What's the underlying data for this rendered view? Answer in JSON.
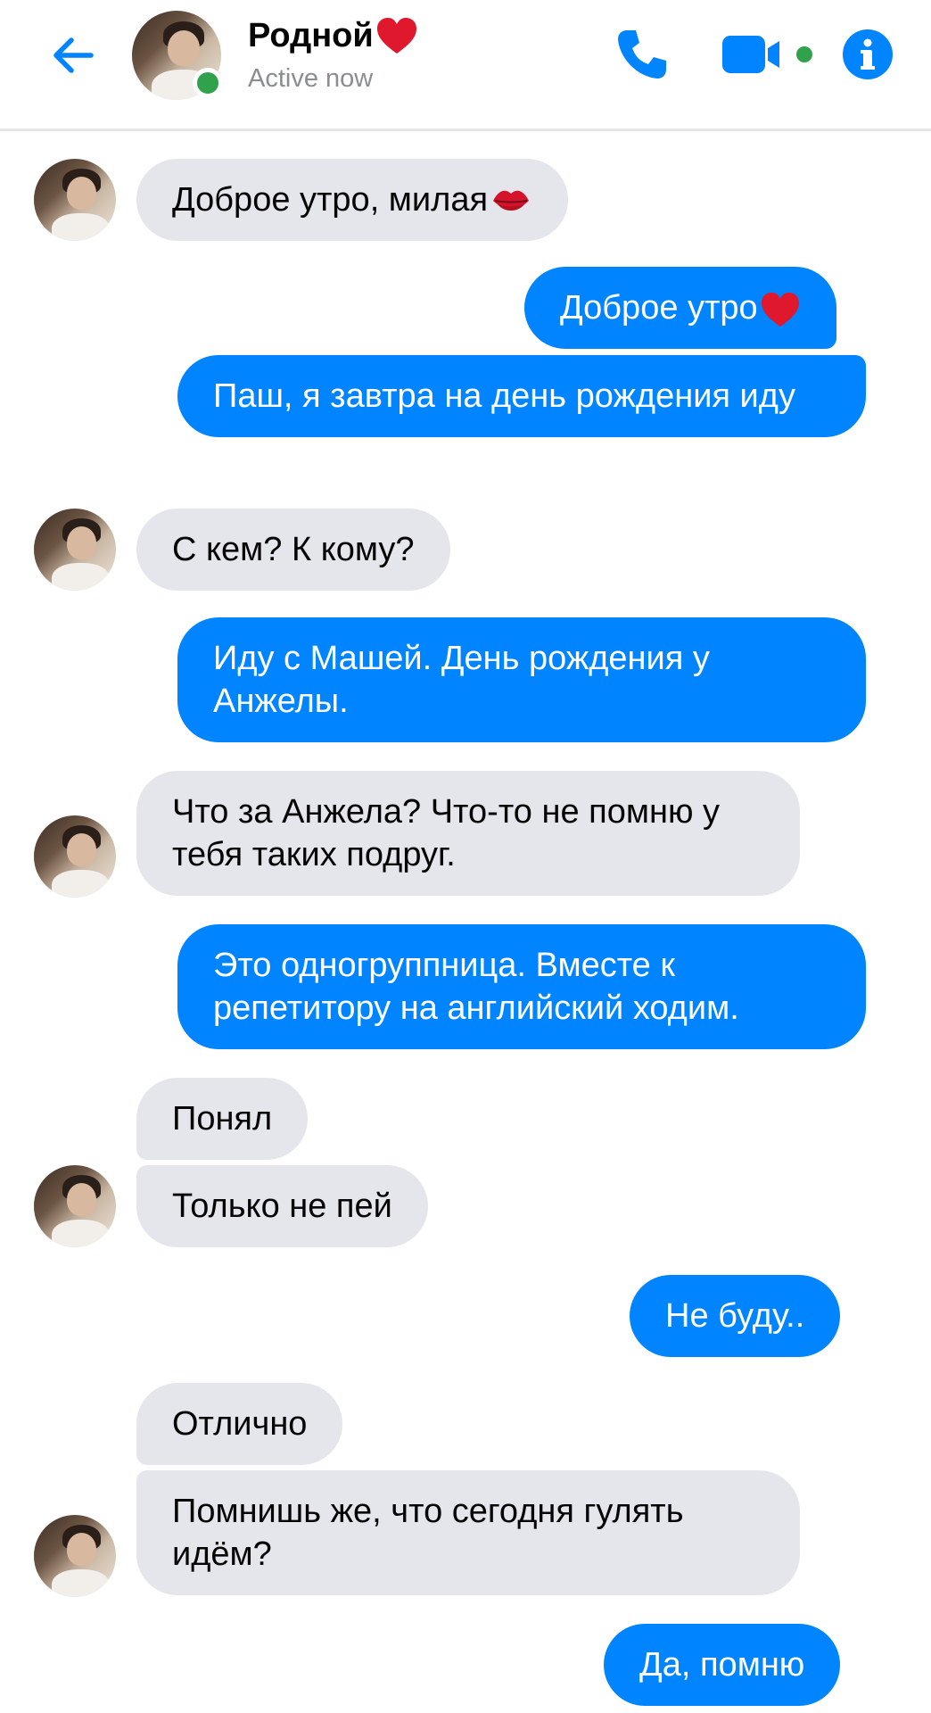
{
  "header": {
    "contact_name": "Родной",
    "contact_status": "Active now",
    "accent_color": "#0084ff",
    "online_color": "#31a24c",
    "icons": {
      "back": "arrow-left-icon",
      "phone": "phone-icon",
      "video": "video-camera-icon",
      "info": "info-icon"
    }
  },
  "messages": [
    {
      "id": "m1",
      "from": "contact",
      "text": "Доброе утро, милая",
      "emoji": "kiss-mark"
    },
    {
      "id": "m2",
      "from": "me",
      "text": "Доброе утро",
      "emoji": "red-heart"
    },
    {
      "id": "m3",
      "from": "me",
      "text": "Паш, я завтра на день рождения иду"
    },
    {
      "id": "m4",
      "from": "contact",
      "text": "С кем? К кому?"
    },
    {
      "id": "m5",
      "from": "me",
      "text": "Иду с Машей. День рождения у Анжелы."
    },
    {
      "id": "m6",
      "from": "contact",
      "text": "Что за Анжела? Что-то не помню у тебя таких подруг."
    },
    {
      "id": "m7",
      "from": "me",
      "text": "Это одногруппница. Вместе к репетитору на английский ходим."
    },
    {
      "id": "m8",
      "from": "contact",
      "text": "Понял"
    },
    {
      "id": "m9",
      "from": "contact",
      "text": "Только не пей"
    },
    {
      "id": "m10",
      "from": "me",
      "text": "Не буду.."
    },
    {
      "id": "m11",
      "from": "contact",
      "text": "Отлично"
    },
    {
      "id": "m12",
      "from": "contact",
      "text": "Помнишь же, что сегодня гулять идём?"
    },
    {
      "id": "m13",
      "from": "me",
      "text": "Да, помню"
    }
  ],
  "colors": {
    "incoming_bubble": "#e4e6eb",
    "outgoing_bubble": "#0084ff"
  }
}
